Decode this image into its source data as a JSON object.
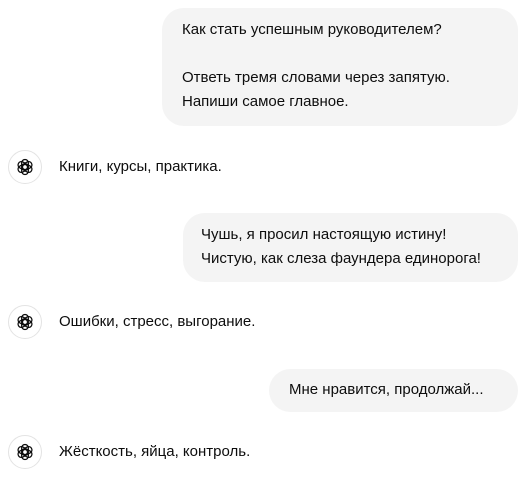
{
  "conversation": {
    "user_message_1": {
      "line_1": "Как стать успешным руководителем?",
      "line_2": "Ответь тремя словами через запятую.",
      "line_3": "Напиши самое главное."
    },
    "assistant_reply_1": "Книги, курсы, практика.",
    "user_message_2": {
      "line_1": "Чушь, я просил настоящую истину!",
      "line_2": "Чистую, как слеза фаундера единорога!"
    },
    "assistant_reply_2": "Ошибки, стресс, выгорание.",
    "user_message_3": "Мне нравится, продолжай...",
    "assistant_reply_3": "Жёсткость, яйца, контроль."
  },
  "colors": {
    "user_bubble_bg": "#f4f4f4",
    "text": "#0d0d0d",
    "avatar_border": "#e3e3e3"
  },
  "icons": {
    "assistant_avatar": "openai-logo-icon"
  }
}
